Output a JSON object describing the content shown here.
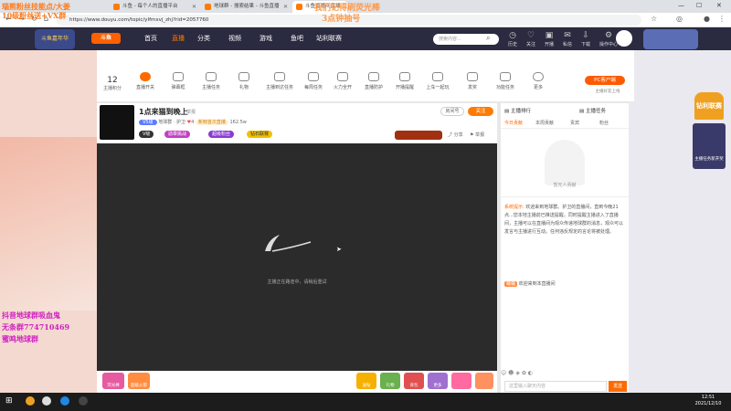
{
  "overlay": {
    "topleft1": "瑙熊粉丝技能点/大姜",
    "topleft2": "10级粉丝送+VX群",
    "topcenter1": "我们记得刷荧光棒",
    "topcenter2": "3点钟抽号",
    "left1": "抖音地球群吸血鬼",
    "left2": "无条群774710469",
    "left3": "蜜鸣地球群"
  },
  "tabs": [
    {
      "label": "斗鱼 - 每个人的直播平台"
    },
    {
      "label": "地球群 - 搜索结果 - 斗鱼直播"
    },
    {
      "label": "斗鱼直播间直播"
    }
  ],
  "url": "https://www.douyu.com/topic/ylfmxvj_zhj?rid=2057760",
  "header": {
    "logo_left": "斗鱼嘉年华",
    "logo": "斗鱼",
    "nav": [
      "首页",
      "直播",
      "分类",
      "视频",
      "游戏",
      "鱼吧",
      "站利联赛"
    ],
    "search_placeholder": "搜索内容...",
    "icons": [
      "历史",
      "关注",
      "开播",
      "私信",
      "下载",
      "操作中心"
    ]
  },
  "toolbar": {
    "count": "12",
    "count_label": "主播积分",
    "tools": [
      "直播开关",
      "弹幕框",
      "主播任务",
      "礼物",
      "主播到达任务",
      "每周任务",
      "火力全开",
      "直播防护",
      "开播提醒",
      "上车一起玩",
      "发奖",
      "功能任务",
      "更多"
    ],
    "pc_button": "PC客户端",
    "pc_sub": "主播好友上线"
  },
  "streamer": {
    "title": "1点来猫到晚上",
    "tags": [
      "举报",
      "主播",
      "推荐"
    ],
    "sub": "地球群 · 护卫",
    "fans": "4",
    "notice": "新鲜首次直播",
    "followers": "162.5w",
    "room": "房间号",
    "follow_btn": "关注",
    "badges": [
      "V5级",
      "勋章挑战",
      "超级粉丝",
      "钻石联赛"
    ],
    "share": "分享",
    "report": "举报"
  },
  "video": {
    "loading_text": "主播正在路途中，请稍后重试"
  },
  "bottom_gifts": [
    "荧光棒",
    "超级火箭",
    "送钻",
    "礼物",
    "背包",
    "更多"
  ],
  "chat": {
    "header_left": "主播排行",
    "header_right": "主播任务",
    "tabs": [
      "今日贡献",
      "本周贡献",
      "贵宾",
      "粉丝"
    ],
    "empty_text": "暂无人贡献",
    "system_label": "系统提示:",
    "system_msg": "欢迎来到地球群。护卫的直播间，直到今晚21点...您本地主播前已推送提醒，同时提醒主播进入了直播间，主播可以在直播间为观众传递地球群的消息，观众可以发言与主播进行互动。任何违反规定的言论将被处理。",
    "user_label": "蛐蛐",
    "user_msg": "欢迎来到本直播间",
    "input_placeholder": "这里输入聊天内容",
    "send_btn": "发送"
  },
  "rightbanner": {
    "title": "钻利联赛",
    "sub": "主播任务新开奖"
  },
  "taskbar": {
    "time": "12:51",
    "date": "2021/12/10"
  }
}
